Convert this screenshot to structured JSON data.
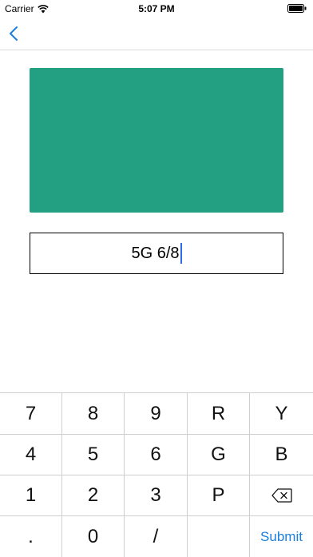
{
  "status_bar": {
    "carrier": "Carrier",
    "time": "5:07 PM"
  },
  "swatch": {
    "color": "#22a081"
  },
  "code_input": {
    "value": "5G 6/8"
  },
  "keyboard": {
    "keys": [
      "7",
      "8",
      "9",
      "R",
      "Y",
      "4",
      "5",
      "6",
      "G",
      "B",
      "1",
      "2",
      "3",
      "P",
      "backspace",
      ".",
      "0",
      "/",
      "",
      ""
    ],
    "submit_label": "Submit"
  },
  "colors": {
    "accent": "#1a7ee0",
    "caret": "#2d6be0"
  }
}
